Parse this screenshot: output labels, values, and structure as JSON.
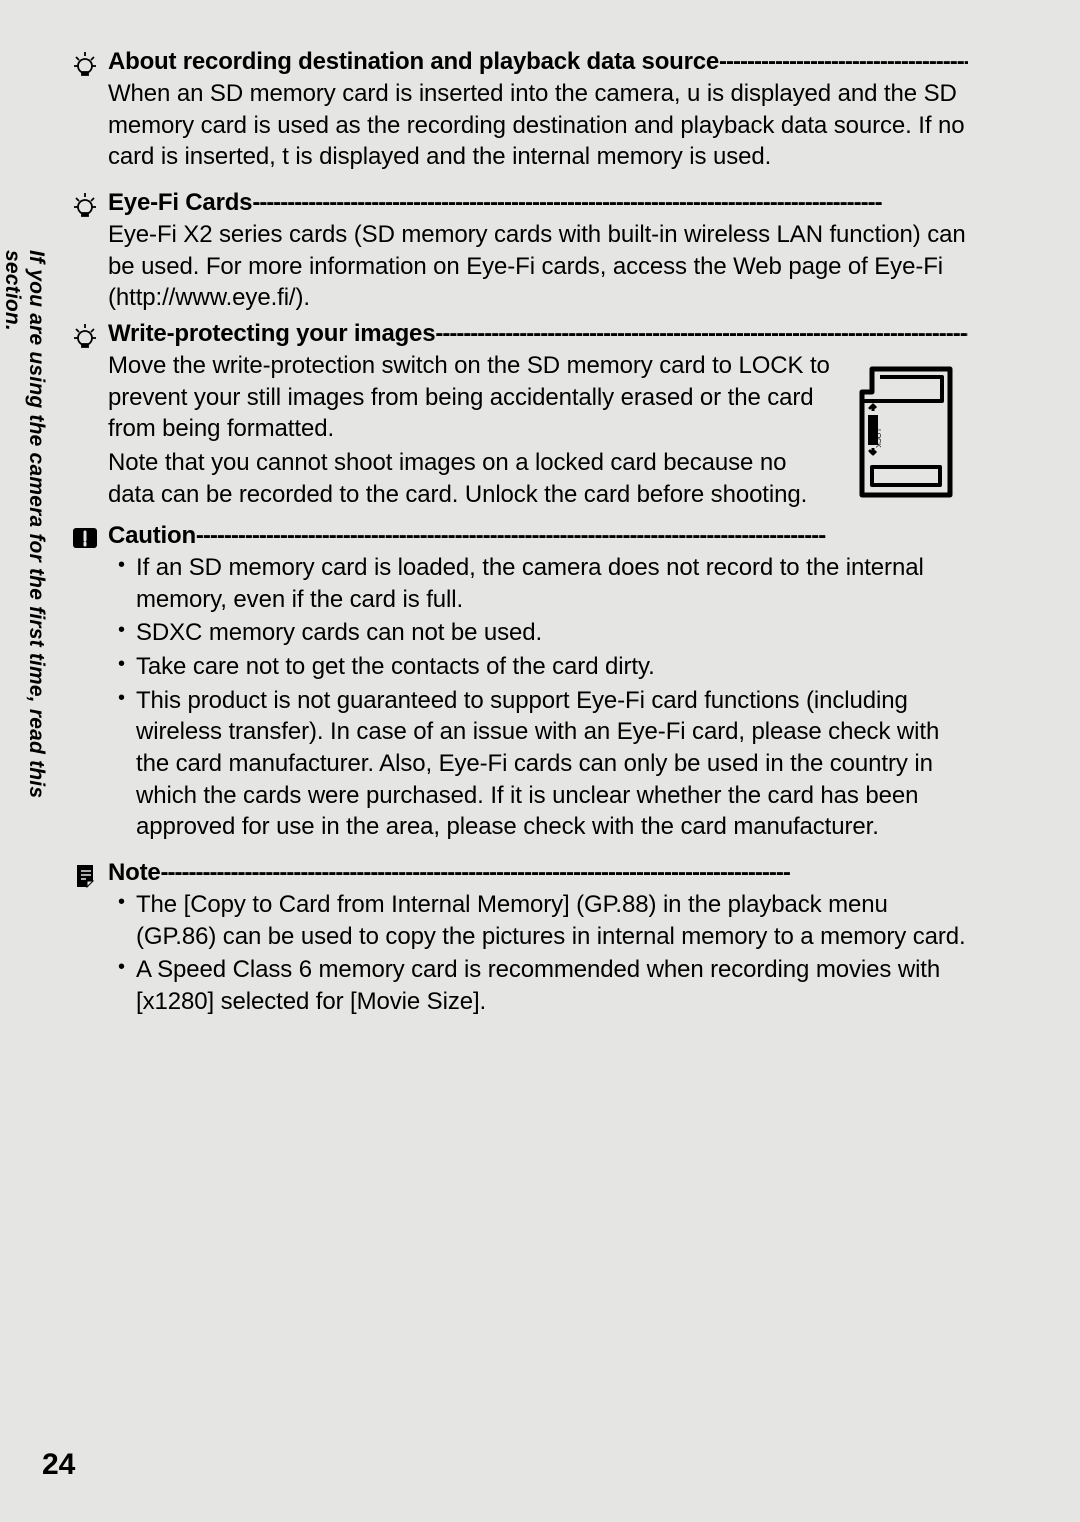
{
  "page_number": "24",
  "side_text": "If you are using the camera for the first time, read this section.",
  "sections": [
    {
      "heading": "About recording destination and playback data source",
      "icon": "tip-bulb-icon",
      "paragraphs": [
        "When an SD memory card is inserted into the camera, u is displayed and the SD memory card is used as the recording destination and playback data source. If no card is inserted, t is displayed and the internal memory is used."
      ]
    },
    {
      "heading": "Eye-Fi Cards",
      "icon": "tip-bulb-icon",
      "paragraphs": [
        "Eye-Fi X2 series cards (SD memory cards with built-in wireless LAN function) can be used. For more information on Eye-Fi cards, access the Web page of Eye-Fi (http://www.eye.fi/)."
      ]
    },
    {
      "heading": "Write-protecting your images",
      "icon": "tip-bulb-icon",
      "has_illustration": true,
      "paragraphs": [
        "Move the write-protection switch on the SD memory card to LOCK to prevent your still images from being accidentally erased or the card from being formatted.",
        "Note that you cannot shoot images on a locked card because no data can be recorded to the card. Unlock the card before shooting."
      ]
    },
    {
      "heading": "Caution",
      "icon": "caution-icon",
      "bullets": [
        "If an SD memory card is loaded, the camera does not record to the internal memory, even if the card is full.",
        "SDXC memory cards can not be used.",
        "Take care not to get the contacts of the card dirty.",
        "This product is not guaranteed to support Eye-Fi card functions (including wireless transfer). In case of an issue with an Eye-Fi card, please check with the card manufacturer. Also, Eye-Fi cards can only be used in the country in which the cards were purchased. If it is unclear whether the card has been approved for use in the area, please check with the card manufacturer."
      ]
    },
    {
      "heading": "Note",
      "icon": "note-icon",
      "bullets": [
        "The [Copy to Card from Internal Memory] (GP.88) in the playback menu (GP.86) can be used to copy the pictures in internal memory to a memory card.",
        "A Speed Class 6 memory card is recommended when recording movies with [x1280] selected for [Movie Size]."
      ]
    }
  ]
}
